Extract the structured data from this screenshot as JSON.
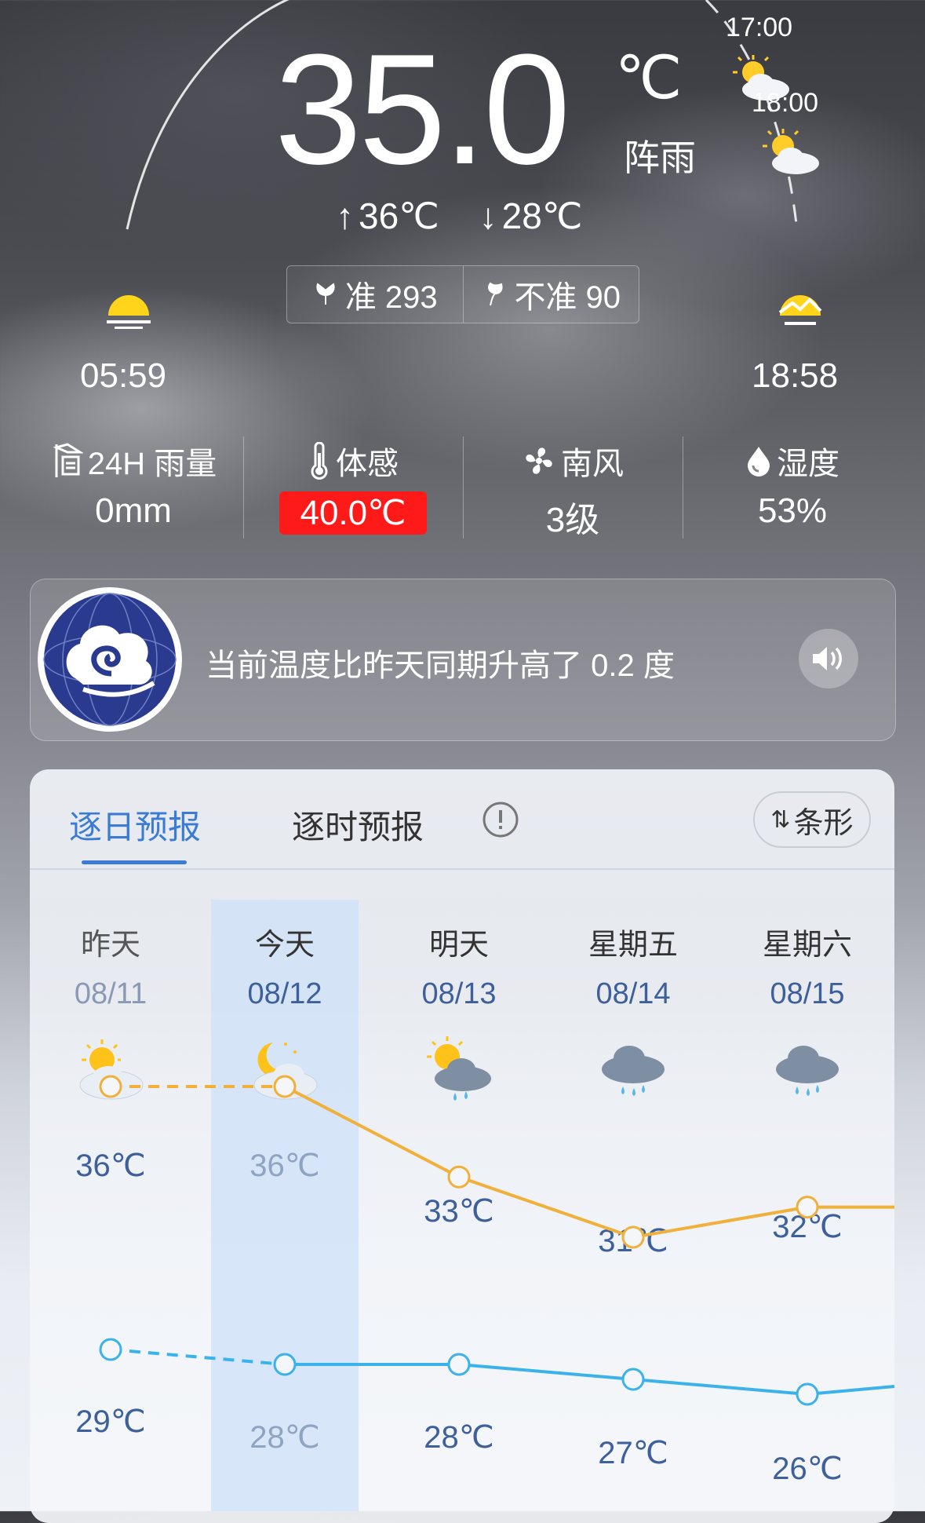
{
  "current": {
    "temperature": "35.0",
    "unit": "℃",
    "condition": "阵雨",
    "high": "36℃",
    "low": "28℃",
    "high_arrow": "↑",
    "low_arrow": "↓"
  },
  "hourly_preview": [
    {
      "time": "17:00",
      "icon": "partly-cloudy-sun-icon"
    },
    {
      "time": "18:00",
      "icon": "partly-cloudy-sun-icon"
    }
  ],
  "accuracy": {
    "accurate_label": "准 293",
    "inaccurate_label": "不准 90"
  },
  "sun": {
    "sunrise": "05:59",
    "sunset": "18:58"
  },
  "stats": [
    {
      "label": "24H 雨量",
      "value": "0mm",
      "icon": "rain-gauge-icon"
    },
    {
      "label": "体感",
      "value": "40.0℃",
      "icon": "thermometer-icon",
      "highlight": "#ff1a1a"
    },
    {
      "label": "南风",
      "value": "3级",
      "icon": "fan-icon"
    },
    {
      "label": "湿度",
      "value": "53%",
      "icon": "droplet-icon"
    }
  ],
  "notice": {
    "text": "当前温度比昨天同期升高了 0.2 度"
  },
  "forecast_tabs": {
    "daily": "逐日预报",
    "hourly": "逐时预报",
    "toggle": "条形"
  },
  "days": [
    {
      "name": "昨天",
      "date": "08/11",
      "icon": "sun-cloud-icon",
      "high": "36℃",
      "low": "29℃"
    },
    {
      "name": "今天",
      "date": "08/12",
      "icon": "moon-cloud-icon",
      "high": "36℃",
      "low": "28℃"
    },
    {
      "name": "明天",
      "date": "08/13",
      "icon": "sun-rain-cloud-icon",
      "high": "33℃",
      "low": "28℃"
    },
    {
      "name": "星期五",
      "date": "08/14",
      "icon": "rain-cloud-icon",
      "high": "31℃",
      "low": "27℃"
    },
    {
      "name": "星期六",
      "date": "08/15",
      "icon": "rain-cloud-icon",
      "high": "32℃",
      "low": "26℃"
    }
  ],
  "chart_data": {
    "type": "line",
    "categories": [
      "08/11",
      "08/12",
      "08/13",
      "08/14",
      "08/15"
    ],
    "series": [
      {
        "values": [
          36,
          36,
          33,
          31,
          32
        ],
        "color": "#f0b03a"
      },
      {
        "values": [
          29,
          28,
          28,
          27,
          26
        ],
        "color": "#3cb2ea"
      }
    ]
  },
  "colors": {
    "accent": "#3a7bd5",
    "high_line": "#f0b03a",
    "low_line": "#3cb2ea",
    "feels_like_bg": "#ff1a1a"
  }
}
